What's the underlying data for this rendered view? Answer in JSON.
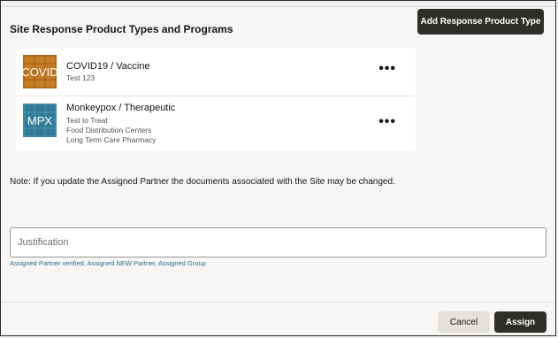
{
  "section": {
    "title": "Site Response Product Types and Programs",
    "add_button_label": "Add Response Product Type"
  },
  "products": [
    {
      "thumb_label": "COVID",
      "title": "COVID19 / Vaccine",
      "programs": [
        "Test 123"
      ],
      "more_label": "•••"
    },
    {
      "thumb_label": "MPX",
      "title": "Monkeypox / Therapeutic",
      "programs": [
        "Test to Treat",
        "Food Distribution Centers",
        "Long Term Care Pharmacy"
      ],
      "more_label": "•••"
    }
  ],
  "note": "Note: If you update the Assigned Partner the documents associated with the Site may be changed.",
  "justification": {
    "value": "",
    "placeholder": "Justification",
    "help_text": "Assigned Partner verified, Assigned NEW Partner, Assigned Group"
  },
  "footer": {
    "cancel_label": "Cancel",
    "assign_label": "Assign"
  },
  "colors": {
    "primary_button": "#302e2b",
    "secondary_button": "#e4e1dc",
    "covid_thumb": "#c57c22",
    "mpx_thumb": "#2f7d9a",
    "help_text": "#2e6a8c"
  }
}
